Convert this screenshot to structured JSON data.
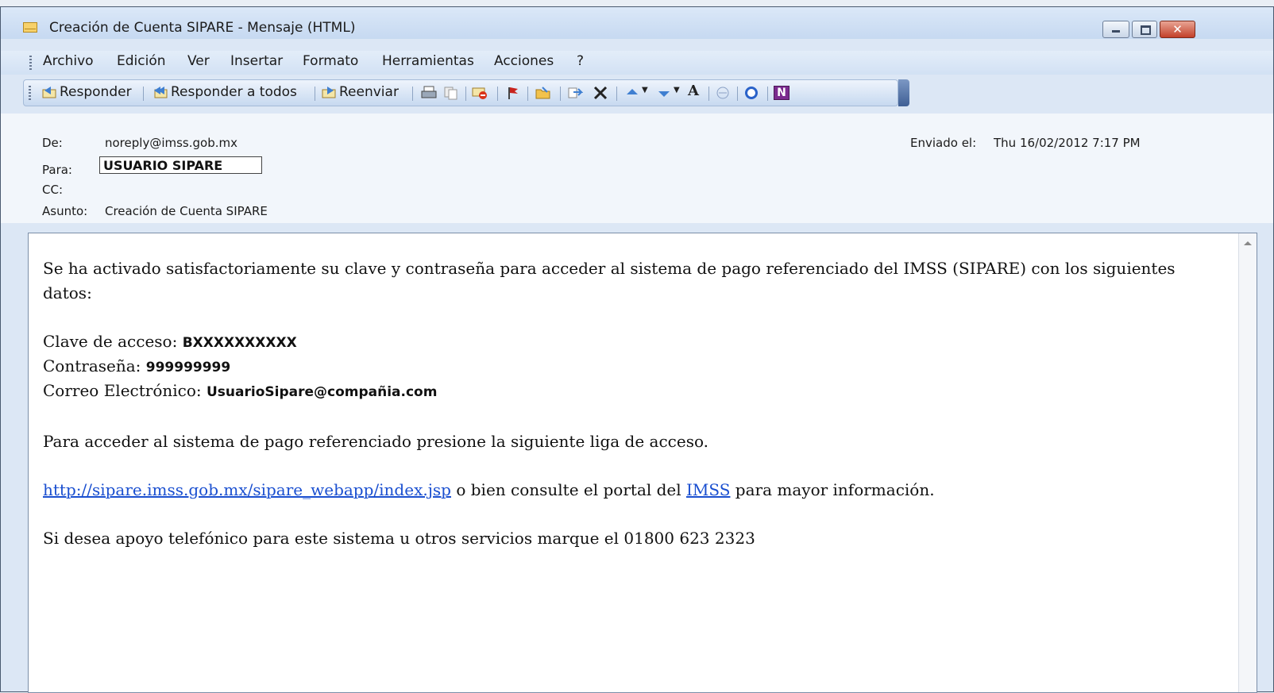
{
  "window": {
    "title": "Creación de Cuenta SIPARE - Mensaje (HTML)",
    "close_symbol": "✕"
  },
  "menu": [
    "Archivo",
    "Edición",
    "Ver",
    "Insertar",
    "Formato",
    "Herramientas",
    "Acciones",
    "?"
  ],
  "toolbar": {
    "reply": "Responder",
    "reply_all": "Responder a todos",
    "forward": "Reenviar",
    "font_grow": "A",
    "onenote": "N"
  },
  "header": {
    "from_label": "De:",
    "from_value": "noreply@imss.gob.mx",
    "to_label": "Para:",
    "to_value": "USUARIO SIPARE",
    "cc_label": "CC:",
    "subject_label": "Asunto:",
    "subject_value": "Creación de Cuenta SIPARE",
    "sent_label": "Enviado el:",
    "sent_value": "Thu 16/02/2012 7:17 PM"
  },
  "body": {
    "intro_line1": "Se ha activado satisfactoriamente su clave y contraseña para acceder al sistema de pago referenciado del IMSS (SIPARE) con los siguientes",
    "intro_line2": "datos:",
    "clave_label": "Clave de acceso: ",
    "clave_value": "BXXXXXXXXXX",
    "password_label": "Contraseña: ",
    "password_value": "999999999",
    "email_label": "Correo Electrónico: ",
    "email_value": "UsuarioSipare@compañia.com",
    "access_text": "Para acceder al sistema de pago referenciado presione la siguiente liga de acceso.",
    "url": "http://sipare.imss.gob.mx/sipare_webapp/index.jsp",
    "url_suffix1": " o bien consulte el portal del ",
    "imss_link": "IMSS",
    "url_suffix2": " para mayor información.",
    "phone_text": "Si desea apoyo telefónico para este sistema u otros servicios marque el 01800 623 2323"
  },
  "icons": [
    "envelope-icon",
    "reply-icon",
    "reply-all-icon",
    "forward-icon",
    "print-icon",
    "copy-icon",
    "delete-message-icon",
    "flag-icon",
    "open-folder-icon",
    "move-icon",
    "delete-icon",
    "up-arrow-icon",
    "down-arrow-icon",
    "font-size-icon",
    "translate-icon",
    "help-icon",
    "onenote-icon",
    "scroll-up-icon"
  ]
}
